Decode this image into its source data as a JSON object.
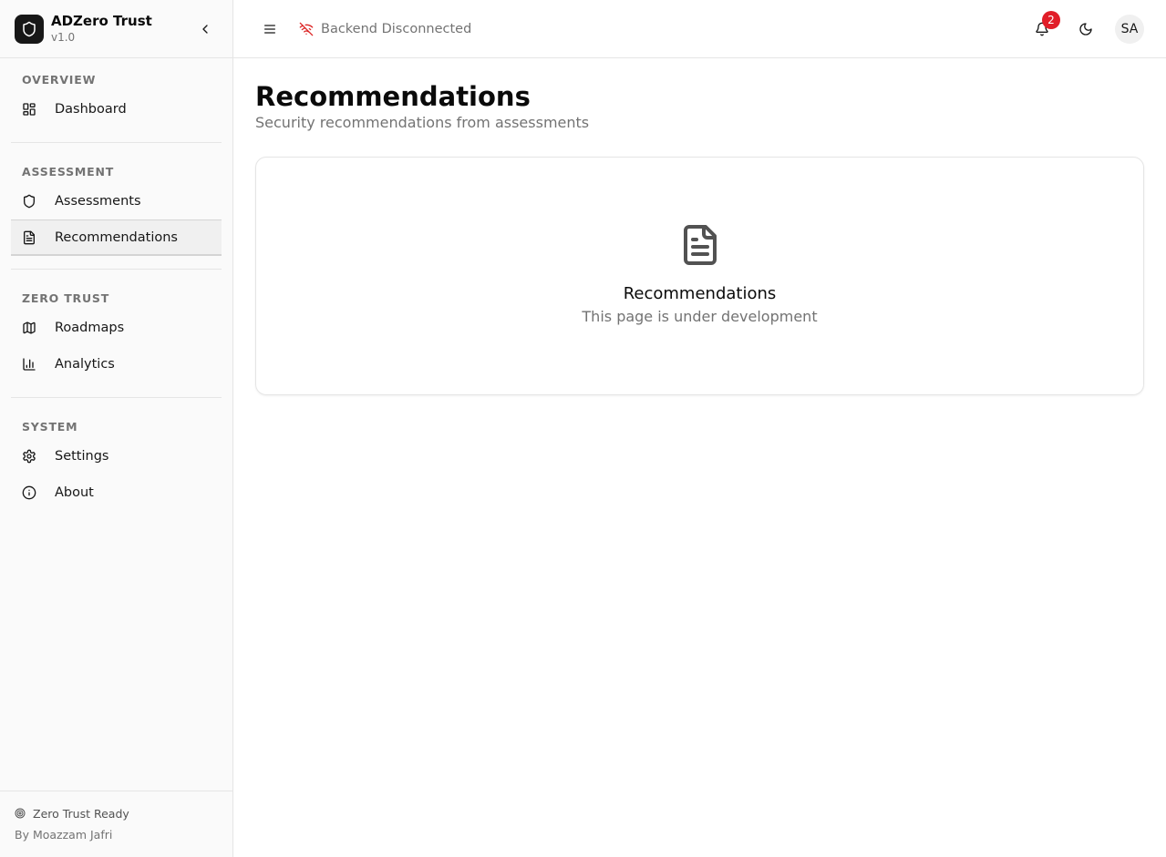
{
  "brand": {
    "name": "ADZero Trust",
    "version": "v1.0",
    "logo_icon": "shield-icon"
  },
  "sidebar": {
    "sections": [
      {
        "heading": "OVERVIEW",
        "items": [
          {
            "label": "Dashboard",
            "icon": "dashboard-icon"
          }
        ]
      },
      {
        "heading": "ASSESSMENT",
        "items": [
          {
            "label": "Assessments",
            "icon": "shield-icon"
          },
          {
            "label": "Recommendations",
            "icon": "file-text-icon",
            "active": true
          }
        ]
      },
      {
        "heading": "ZERO TRUST",
        "items": [
          {
            "label": "Roadmaps",
            "icon": "map-icon"
          },
          {
            "label": "Analytics",
            "icon": "bar-chart-icon"
          }
        ]
      },
      {
        "heading": "SYSTEM",
        "items": [
          {
            "label": "Settings",
            "icon": "gear-icon"
          },
          {
            "label": "About",
            "icon": "info-icon"
          }
        ]
      }
    ],
    "footer": {
      "status": "Zero Trust Ready",
      "author": "By Moazzam Jafri"
    }
  },
  "header": {
    "connection_status": "Backend Disconnected",
    "notification_count": "2",
    "avatar_initials": "SA"
  },
  "main": {
    "title": "Recommendations",
    "subtitle": "Security recommendations from assessments",
    "card": {
      "title": "Recommendations",
      "description": "This page is under development",
      "icon": "file-text-icon"
    }
  },
  "colors": {
    "accent_dark": "#171717",
    "badge": "#e11d28",
    "disconnected": "#dc2626",
    "muted_text": "#737373"
  }
}
